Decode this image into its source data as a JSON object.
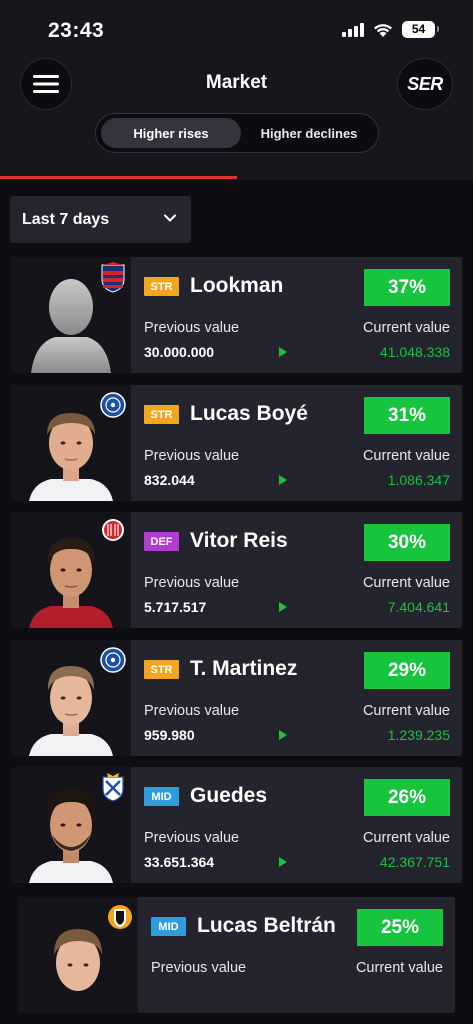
{
  "status": {
    "time": "23:43",
    "battery": "54"
  },
  "header": {
    "title": "Market",
    "brand": "SER"
  },
  "tabs": {
    "active": "Higher rises",
    "inactive": "Higher declines"
  },
  "filter": {
    "period": "Last 7 days"
  },
  "labels": {
    "previous": "Previous value",
    "current": "Current value"
  },
  "colors": {
    "accent_green": "#17c43d",
    "accent_red": "#e2332b",
    "str": "#f5a51d",
    "def": "#b23bd4",
    "mid": "#2d9de0"
  },
  "players": [
    {
      "position": "STR",
      "name": "Lookman",
      "change": "37%",
      "previous": "30.000.000",
      "current": "41.048.338",
      "club_icon": "atletico-madrid-crest",
      "photo": "silhouette-placeholder"
    },
    {
      "position": "STR",
      "name": "Lucas Boyé",
      "change": "31%",
      "previous": "832.044",
      "current": "1.086.347",
      "club_icon": "alaves-crest",
      "photo": "player-photo"
    },
    {
      "position": "DEF",
      "name": "Vitor Reis",
      "change": "30%",
      "previous": "5.717.517",
      "current": "7.404.641",
      "club_icon": "girona-crest",
      "photo": "player-photo"
    },
    {
      "position": "STR",
      "name": "T. Martinez",
      "change": "29%",
      "previous": "959.980",
      "current": "1.239.235",
      "club_icon": "alaves-crest",
      "photo": "player-photo"
    },
    {
      "position": "MID",
      "name": "Guedes",
      "change": "26%",
      "previous": "33.651.364",
      "current": "42.367.751",
      "club_icon": "real-sociedad-crest",
      "photo": "player-photo"
    },
    {
      "position": "MID",
      "name": "Lucas Beltrán",
      "change": "25%",
      "previous": "",
      "current": "",
      "club_icon": "valencia-crest",
      "photo": "player-photo"
    }
  ]
}
